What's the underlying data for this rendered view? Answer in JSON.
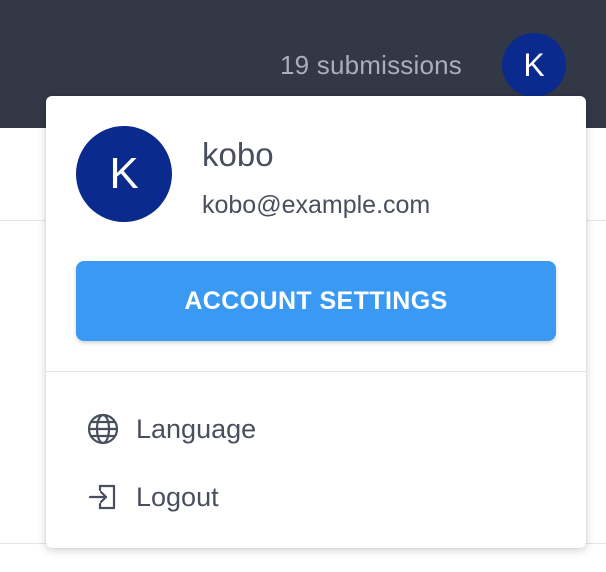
{
  "header": {
    "submissions_text": "19 submissions",
    "avatar_initial": "K"
  },
  "account_menu": {
    "avatar_initial": "K",
    "username": "kobo",
    "email": "kobo@example.com",
    "settings_button_label": "ACCOUNT SETTINGS",
    "items": [
      {
        "label": "Language",
        "icon": "globe-icon"
      },
      {
        "label": "Logout",
        "icon": "logout-icon"
      }
    ]
  },
  "colors": {
    "header_bg": "#333846",
    "avatar_bg": "#0b2a8d",
    "primary_button": "#3a99f2",
    "text": "#4a4f5e",
    "muted_text": "#a9aebb"
  }
}
